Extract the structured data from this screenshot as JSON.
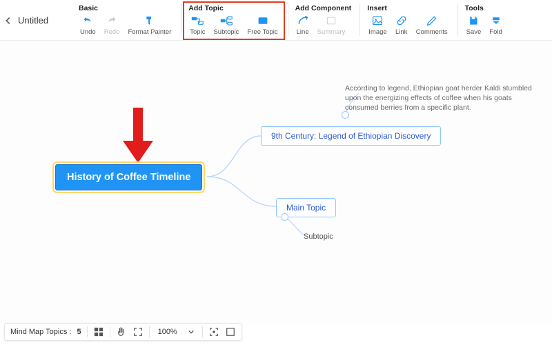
{
  "doc": {
    "title": "Untitled"
  },
  "toolbar": {
    "groups": {
      "basic": {
        "title": "Basic",
        "undo": "Undo",
        "redo": "Redo",
        "format_painter": "Format Painter"
      },
      "add_topic": {
        "title": "Add Topic",
        "topic": "Topic",
        "subtopic": "Subtopic",
        "free_topic": "Free Topic"
      },
      "add_component": {
        "title": "Add Component",
        "line": "Line",
        "summary": "Summary"
      },
      "insert": {
        "title": "Insert",
        "image": "Image",
        "link": "Link",
        "comments": "Comments"
      },
      "tools": {
        "title": "Tools",
        "save": "Save",
        "fold": "Fold"
      }
    }
  },
  "mindmap": {
    "central": "History of Coffee Timeline",
    "branch_a": "9th Century: Legend of Ethiopian Discovery",
    "note_a": "According to legend, Ethiopian goat herder Kaldi stumbled upon the energizing effects of coffee when his goats consumed berries from a specific plant.",
    "branch_b": "Main Topic",
    "sub_b": "Subtopic"
  },
  "status": {
    "label": "Mind Map Topics :",
    "count": "5",
    "zoom": "100%"
  },
  "colors": {
    "accent": "#2094f4",
    "highlight": "#e33b1e"
  }
}
